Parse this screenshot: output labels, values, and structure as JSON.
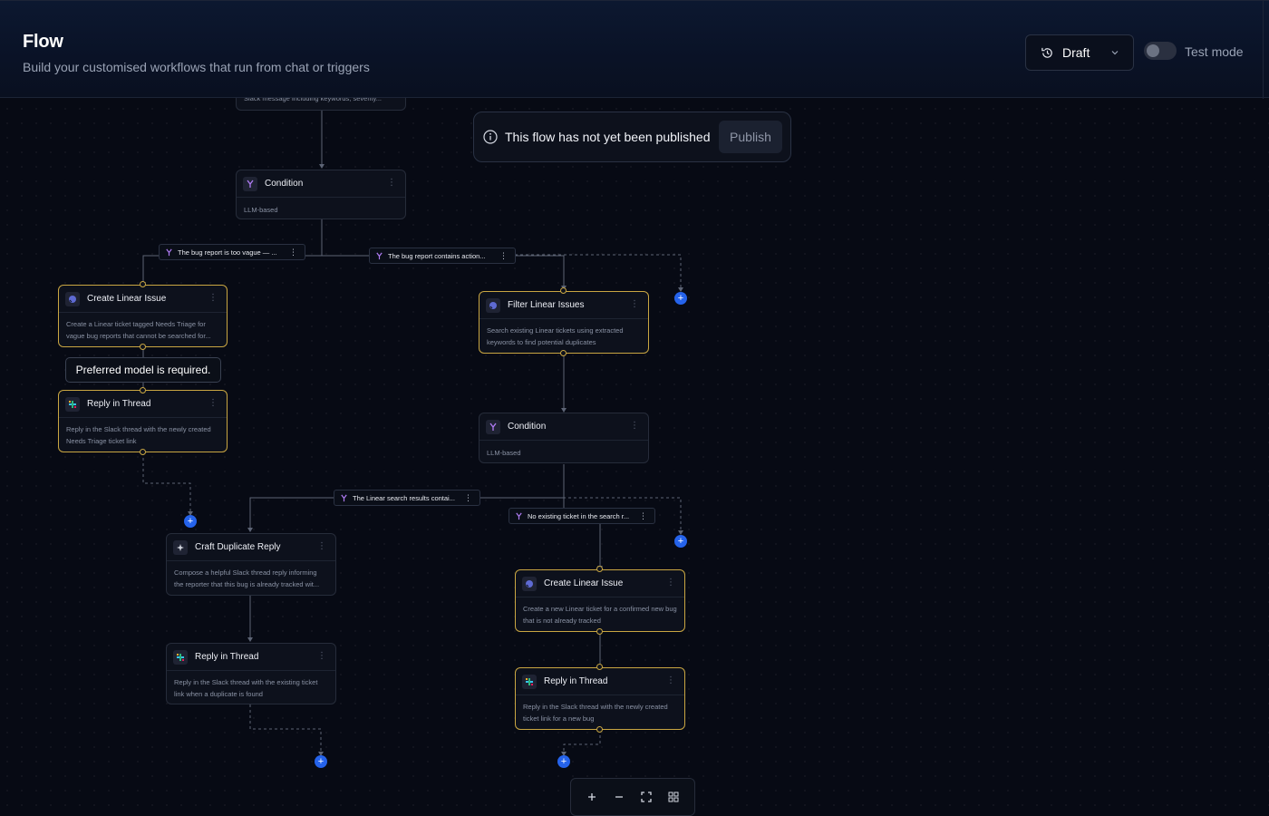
{
  "header": {
    "title": "Flow",
    "subtitle": "Build your customised workflows that run from chat or triggers",
    "draft_label": "Draft",
    "test_mode_label": "Test mode",
    "test_mode_on": false
  },
  "notice": {
    "text": "This flow has not yet been published",
    "publish_label": "Publish"
  },
  "tooltip": {
    "text": "Preferred model is required."
  },
  "nodes": {
    "trigger": {
      "desc": "Slack message including keywords, severity..."
    },
    "condition1": {
      "title": "Condition",
      "desc": "LLM-based"
    },
    "create_issue_vague": {
      "title": "Create Linear Issue",
      "desc": "Create a Linear ticket tagged Needs Triage for vague bug reports that cannot be searched for..."
    },
    "reply_vague": {
      "title": "Reply in Thread",
      "desc": "Reply in the Slack thread with the newly created Needs Triage ticket link"
    },
    "filter_issues": {
      "title": "Filter Linear Issues",
      "desc": "Search existing Linear tickets using extracted keywords to find potential duplicates"
    },
    "condition2": {
      "title": "Condition",
      "desc": "LLM-based"
    },
    "craft_reply": {
      "title": "Craft Duplicate Reply",
      "desc": "Compose a helpful Slack thread reply informing the reporter that this bug is already tracked wit..."
    },
    "reply_duplicate": {
      "title": "Reply in Thread",
      "desc": "Reply in the Slack thread with the existing ticket link when a duplicate is found"
    },
    "create_issue_new": {
      "title": "Create Linear Issue",
      "desc": "Create a new Linear ticket for a confirmed new bug that is not already tracked"
    },
    "reply_new": {
      "title": "Reply in Thread",
      "desc": "Reply in the Slack thread with the newly created ticket link for a new bug"
    }
  },
  "edge_labels": {
    "vague": "The bug report is too vague — ...",
    "actionable": "The bug report contains action...",
    "found": "The Linear search results contai...",
    "not_found": "No existing ticket in the search r..."
  },
  "zoom_controls": [
    "zoom-in",
    "zoom-out",
    "fit-view",
    "layout"
  ],
  "colors": {
    "accent_blue": "#2563eb",
    "selected_gold": "#c9a642",
    "background": "#070a14"
  }
}
